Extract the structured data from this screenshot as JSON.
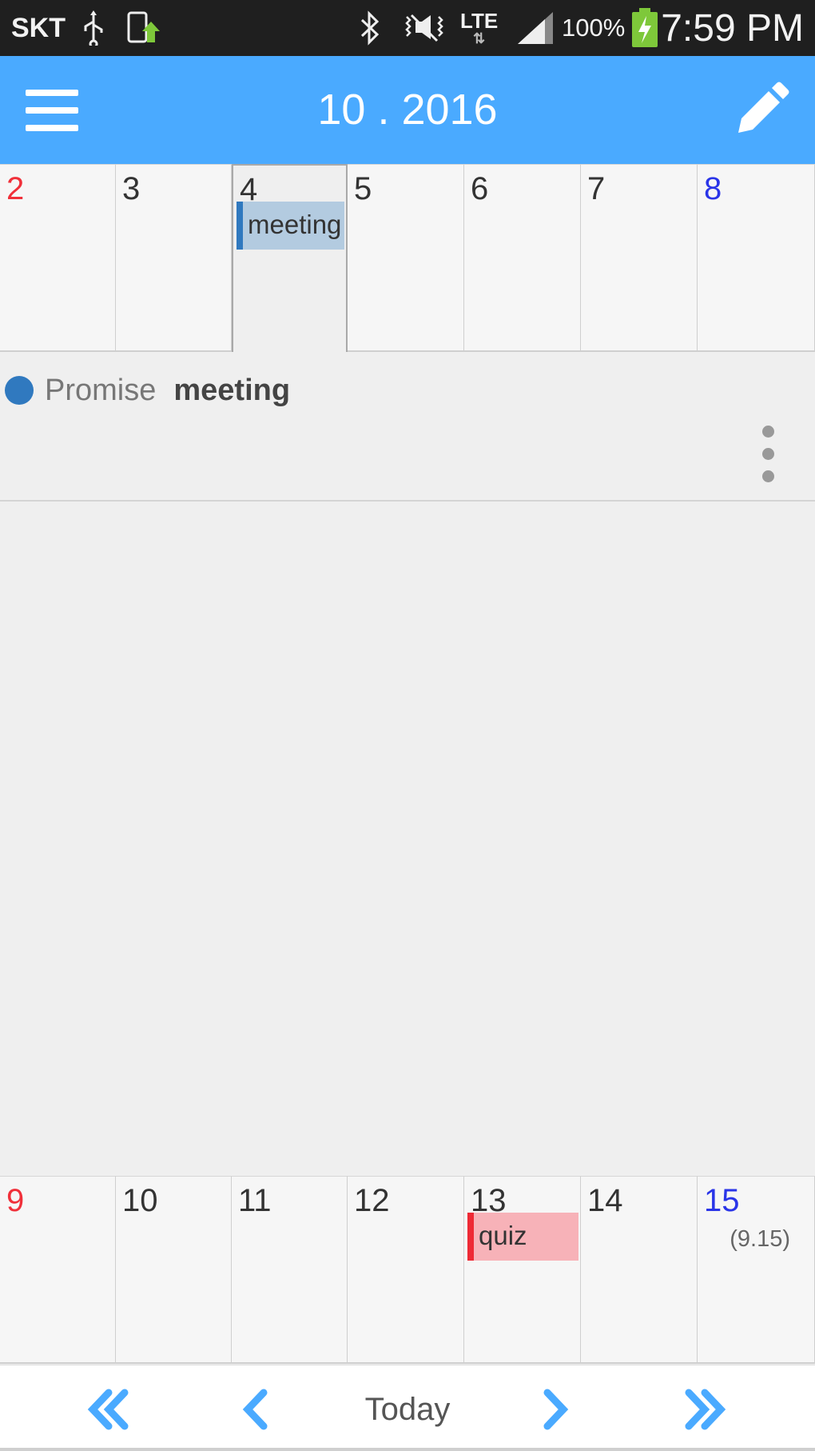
{
  "status_bar": {
    "carrier": "SKT",
    "network": "LTE",
    "battery": "100%",
    "time": "7:59 PM",
    "icons": [
      "usb-icon",
      "phone-upload-icon",
      "bluetooth-icon",
      "mute-icon",
      "signal-icon",
      "battery-charging-icon"
    ]
  },
  "header": {
    "title": "10 . 2016",
    "icons": [
      "menu-icon",
      "pencil-icon"
    ]
  },
  "week1": [
    {
      "day": "2",
      "color": "#f0303a"
    },
    {
      "day": "3"
    },
    {
      "day": "4",
      "selected": true,
      "event": "meeting"
    },
    {
      "day": "5"
    },
    {
      "day": "6"
    },
    {
      "day": "7"
    },
    {
      "day": "8",
      "color": "#2a35e8"
    }
  ],
  "week2": [
    {
      "day": "9",
      "color": "#f0303a"
    },
    {
      "day": "10"
    },
    {
      "day": "11"
    },
    {
      "day": "12"
    },
    {
      "day": "13",
      "event": "quiz"
    },
    {
      "day": "14"
    },
    {
      "day": "15",
      "color": "#2a35e8",
      "lunar": "(9.15)"
    }
  ],
  "detail": {
    "category": "Promise",
    "title": "meeting",
    "dot_color": "#3079bf"
  },
  "nav": {
    "today_label": "Today",
    "icons": [
      "double-chevron-left-icon",
      "chevron-left-icon",
      "chevron-right-icon",
      "double-chevron-right-icon"
    ]
  },
  "colors": {
    "accent": "#4aaaff",
    "event_blue": "#b3cbe0",
    "event_red": "#f7b2b8"
  }
}
